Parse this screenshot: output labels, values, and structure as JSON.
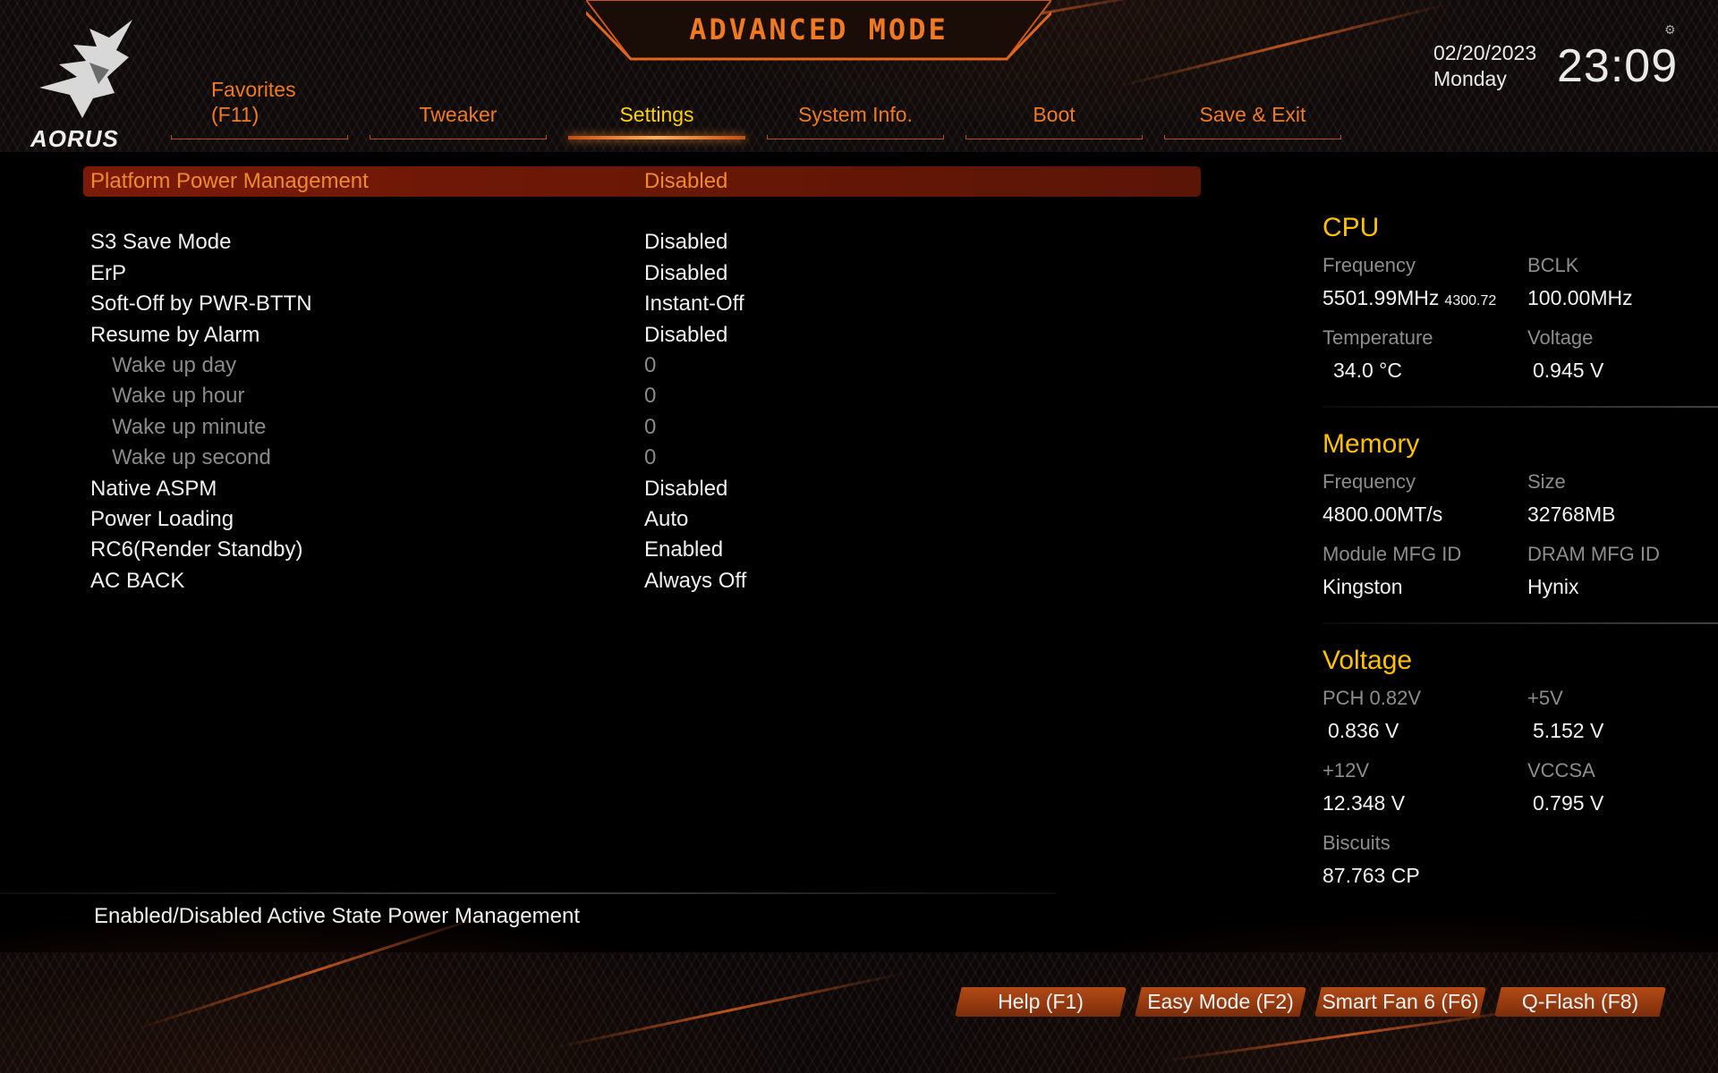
{
  "header": {
    "mode_title": "ADVANCED MODE",
    "logo_text": "AORUS",
    "date": "02/20/2023",
    "weekday": "Monday",
    "time": "23:09"
  },
  "tabs": [
    {
      "label_line1": "Favorites",
      "label_line2": "(F11)",
      "active": false
    },
    {
      "label": "Tweaker",
      "active": false
    },
    {
      "label": "Settings",
      "active": true
    },
    {
      "label": "System Info.",
      "active": false
    },
    {
      "label": "Boot",
      "active": false
    },
    {
      "label": "Save & Exit",
      "active": false
    }
  ],
  "settings": {
    "selected": {
      "label": "Platform Power Management",
      "value": "Disabled"
    },
    "rows": [
      {
        "label": "S3 Save Mode",
        "value": "Disabled"
      },
      {
        "label": "ErP",
        "value": "Disabled"
      },
      {
        "label": "Soft-Off by PWR-BTTN",
        "value": "Instant-Off"
      },
      {
        "label": "Resume by Alarm",
        "value": "Disabled"
      },
      {
        "label": "Wake up day",
        "value": "0"
      },
      {
        "label": "Wake up hour",
        "value": "0"
      },
      {
        "label": "Wake up minute",
        "value": "0"
      },
      {
        "label": "Wake up second",
        "value": "0"
      },
      {
        "label": "Native ASPM",
        "value": "Disabled"
      },
      {
        "label": "Power Loading",
        "value": "Auto"
      },
      {
        "label": "RC6(Render Standby)",
        "value": "Enabled"
      },
      {
        "label": "AC BACK",
        "value": "Always Off"
      }
    ]
  },
  "help_text": "Enabled/Disabled Active State Power Management",
  "cpu": {
    "title": "CPU",
    "frequency_label": "Frequency",
    "frequency": "5501.99MHz",
    "frequency_sub": "4300.72",
    "bclk_label": "BCLK",
    "bclk": "100.00MHz",
    "temperature_label": "Temperature",
    "temperature": "34.0 °C",
    "voltage_label": "Voltage",
    "voltage": "0.945 V"
  },
  "memory": {
    "title": "Memory",
    "frequency_label": "Frequency",
    "frequency": "4800.00MT/s",
    "size_label": "Size",
    "size": "32768MB",
    "module_mfg_label": "Module MFG ID",
    "module_mfg": "Kingston",
    "dram_mfg_label": "DRAM MFG ID",
    "dram_mfg": "Hynix"
  },
  "voltage": {
    "title": "Voltage",
    "pch_label": "PCH 0.82V",
    "pch": "0.836 V",
    "p5v_label": "+5V",
    "p5v": "5.152 V",
    "p12v_label": "+12V",
    "p12v": "12.348 V",
    "vccsa_label": "VCCSA",
    "vccsa": "0.795 V",
    "biscuits_label": "Biscuits",
    "biscuits": "87.763 CP"
  },
  "footer": {
    "help": "Help (F1)",
    "easy_mode": "Easy Mode (F2)",
    "smart_fan": "Smart Fan 6 (F6)",
    "qflash": "Q-Flash (F8)"
  },
  "colors": {
    "accent": "#f07a22",
    "active_tab": "#ffd200",
    "section_title": "#ffc000",
    "selected_row_bg": "#7a1a07"
  }
}
